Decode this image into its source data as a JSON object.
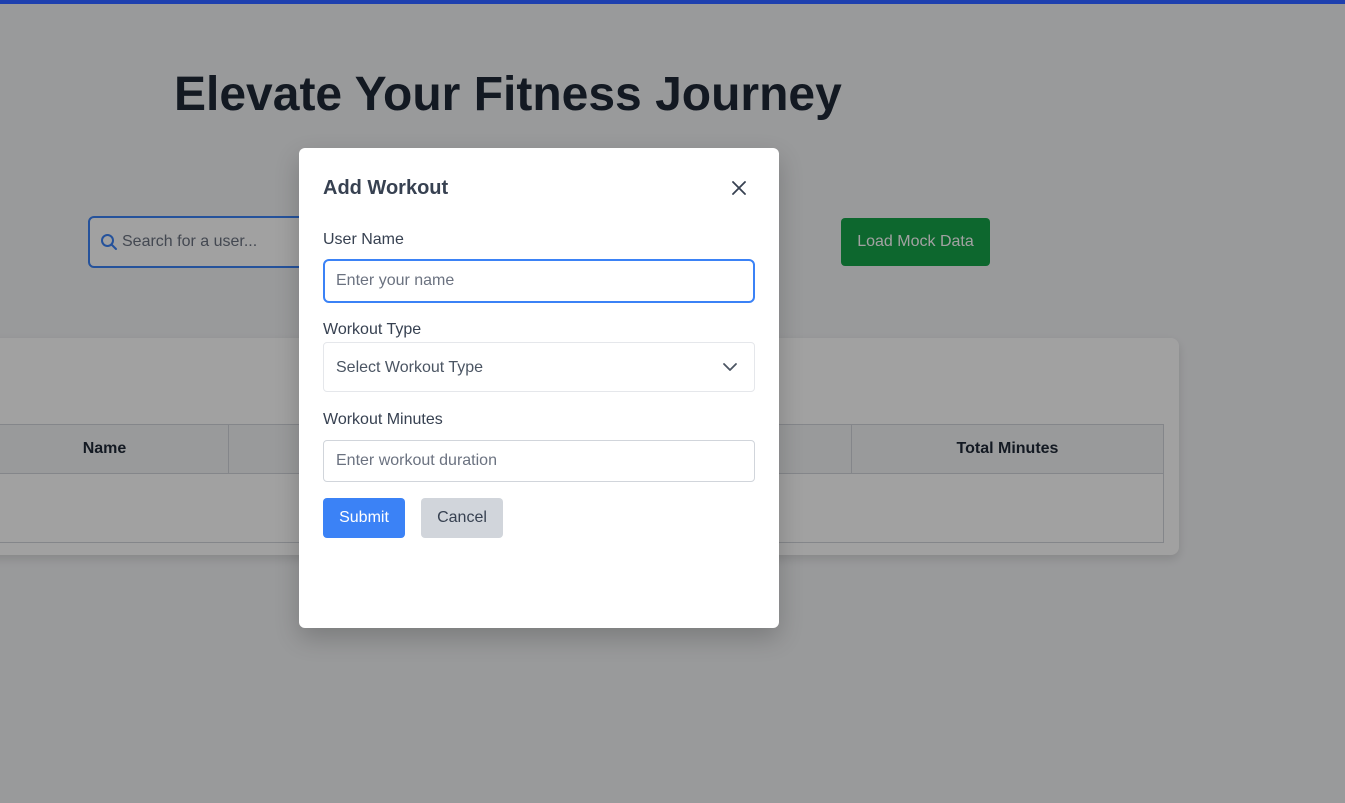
{
  "page": {
    "title": "Elevate Your Fitness Journey"
  },
  "search": {
    "placeholder": "Search for a user...",
    "icon": "search-icon"
  },
  "toolbar": {
    "load_mock_label": "Load Mock Data"
  },
  "table": {
    "columns": [
      "Name",
      "",
      "",
      "Total Minutes"
    ],
    "rows": []
  },
  "modal": {
    "title": "Add Workout",
    "close_icon": "close-icon",
    "fields": {
      "user_name": {
        "label": "User Name",
        "placeholder": "Enter your name",
        "value": ""
      },
      "workout_type": {
        "label": "Workout Type",
        "selected": "Select Workout Type",
        "icon": "chevron-down-icon"
      },
      "workout_minutes": {
        "label": "Workout Minutes",
        "placeholder": "Enter workout duration",
        "value": ""
      }
    },
    "submit_label": "Submit",
    "cancel_label": "Cancel"
  },
  "colors": {
    "top_bar": "#1e40af",
    "primary": "#3b82f6",
    "success": "#16a34a",
    "cancel": "#d1d5db"
  }
}
